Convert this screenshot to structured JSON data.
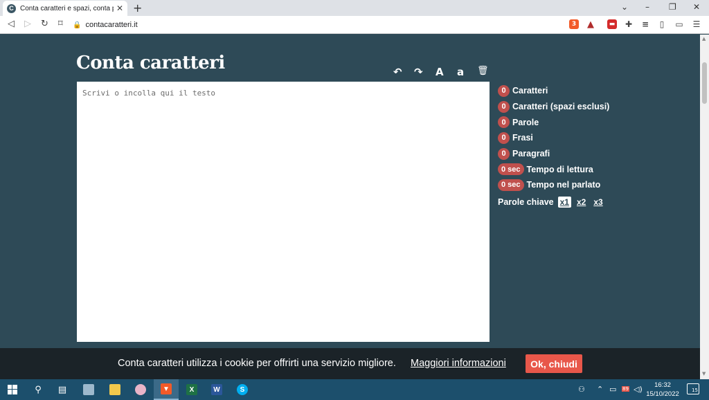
{
  "browser": {
    "tab_title": "Conta caratteri e spazi, conta parole",
    "tab_favicon_letter": "C",
    "url": "contacaratteri.it",
    "new_tab": "+",
    "minimize": "–",
    "restore": "❐",
    "close": "✕",
    "tab_dropdown": "⌄",
    "ext_badge": "3"
  },
  "site": {
    "title": "Conta caratteri",
    "toolbar": {
      "undo": "↶",
      "redo": "↷",
      "uppercase": "A",
      "lowercase": "a",
      "delete": "🗑"
    },
    "textarea_placeholder": "Scrivi o incolla qui il testo",
    "stats": [
      {
        "value": "0",
        "label": "Caratteri"
      },
      {
        "value": "0",
        "label": "Caratteri (spazi esclusi)"
      },
      {
        "value": "0",
        "label": "Parole"
      },
      {
        "value": "0",
        "label": "Frasi"
      },
      {
        "value": "0",
        "label": "Paragrafi"
      },
      {
        "value": "0 sec",
        "label": "Tempo di lettura"
      },
      {
        "value": "0 sec",
        "label": "Tempo nel parlato"
      }
    ],
    "keywords": {
      "label": "Parole chiave",
      "options": [
        "x1",
        "x2",
        "x3"
      ],
      "active": "x1"
    }
  },
  "cookie": {
    "text": "Conta caratteri utilizza i cookie per offrirti una servizio migliore.",
    "link": "Maggiori informazioni",
    "button": "Ok, chiudi"
  },
  "taskbar": {
    "time": "16:32",
    "date": "15/10/2022",
    "battery_badge": "89",
    "notifications_count": "15",
    "apps": [
      "windows-start",
      "search",
      "task-view",
      "notepad",
      "file-explorer",
      "paint",
      "brave",
      "excel",
      "word",
      "skype"
    ]
  },
  "colors": {
    "page_bg": "#2e4a57",
    "badge": "#c0504d",
    "cookie_button": "#e8574a",
    "taskbar": "#1c4f6c"
  }
}
